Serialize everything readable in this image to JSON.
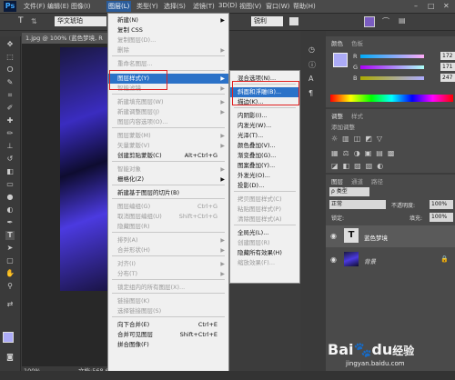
{
  "menubar": {
    "logo": "Ps",
    "items": [
      "文件(F)",
      "编辑(E)",
      "图像(I)",
      "图层(L)",
      "类型(Y)",
      "选择(S)",
      "滤镜(T)",
      "3D(D)",
      "视图(V)",
      "窗口(W)",
      "帮助(H)"
    ],
    "window_buttons": [
      "–",
      "□",
      "✕"
    ]
  },
  "options": {
    "tool_glyph": "T",
    "font_name": "华文琥珀",
    "sharpen": "锐利"
  },
  "document": {
    "tab_title": "1.jpg @ 100% (蓝色梦境, R",
    "zoom": "100%",
    "doc_size": "文档:568.6"
  },
  "layer_menu": {
    "items": [
      {
        "label": "新建(N)",
        "shortcut": "",
        "arrow": true,
        "disabled": false
      },
      {
        "label": "复制 CSS",
        "shortcut": "",
        "arrow": false,
        "disabled": false
      },
      {
        "label": "复制图层(D)...",
        "shortcut": "",
        "arrow": false,
        "disabled": true
      },
      {
        "label": "删除",
        "shortcut": "",
        "arrow": true,
        "disabled": true
      },
      {
        "label": "重命名图层...",
        "shortcut": "",
        "arrow": false,
        "disabled": true
      },
      {
        "label": "图层样式(Y)",
        "shortcut": "",
        "arrow": true,
        "disabled": false
      },
      {
        "label": "智能滤镜",
        "shortcut": "",
        "arrow": true,
        "disabled": true
      },
      {
        "label": "新建填充图层(W)",
        "shortcut": "",
        "arrow": true,
        "disabled": true
      },
      {
        "label": "新建调整图层(J)",
        "shortcut": "",
        "arrow": true,
        "disabled": true
      },
      {
        "label": "图层内容选项(O)...",
        "shortcut": "",
        "arrow": false,
        "disabled": true
      },
      {
        "label": "图层蒙版(M)",
        "shortcut": "",
        "arrow": true,
        "disabled": true
      },
      {
        "label": "矢量蒙版(V)",
        "shortcut": "",
        "arrow": true,
        "disabled": true
      },
      {
        "label": "创建剪贴蒙版(C)",
        "shortcut": "Alt+Ctrl+G",
        "arrow": false,
        "disabled": false
      },
      {
        "label": "智能对象",
        "shortcut": "",
        "arrow": true,
        "disabled": true
      },
      {
        "label": "栅格化(Z)",
        "shortcut": "",
        "arrow": true,
        "disabled": false
      },
      {
        "label": "新建基于图层的切片(B)",
        "shortcut": "",
        "arrow": false,
        "disabled": false
      },
      {
        "label": "图层编组(G)",
        "shortcut": "Ctrl+G",
        "arrow": false,
        "disabled": true
      },
      {
        "label": "取消图层编组(U)",
        "shortcut": "Shift+Ctrl+G",
        "arrow": false,
        "disabled": true
      },
      {
        "label": "隐藏图层(R)",
        "shortcut": "",
        "arrow": false,
        "disabled": true
      },
      {
        "label": "排列(A)",
        "shortcut": "",
        "arrow": true,
        "disabled": true
      },
      {
        "label": "合并形状(H)",
        "shortcut": "",
        "arrow": true,
        "disabled": true
      },
      {
        "label": "对齐(I)",
        "shortcut": "",
        "arrow": true,
        "disabled": true
      },
      {
        "label": "分布(T)",
        "shortcut": "",
        "arrow": true,
        "disabled": true
      },
      {
        "label": "锁定组内的所有图层(X)...",
        "shortcut": "",
        "arrow": false,
        "disabled": true
      },
      {
        "label": "链接图层(K)",
        "shortcut": "",
        "arrow": false,
        "disabled": true
      },
      {
        "label": "选择链接图层(S)",
        "shortcut": "",
        "arrow": false,
        "disabled": true
      },
      {
        "label": "向下合并(E)",
        "shortcut": "Ctrl+E",
        "arrow": false,
        "disabled": false
      },
      {
        "label": "合并可见图层",
        "shortcut": "Shift+Ctrl+E",
        "arrow": false,
        "disabled": false
      },
      {
        "label": "拼合图像(F)",
        "shortcut": "",
        "arrow": false,
        "disabled": false
      }
    ]
  },
  "style_submenu": {
    "items": [
      {
        "label": "混合选项(N)...",
        "disabled": false
      },
      {
        "label": "斜面和浮雕(B)...",
        "disabled": false
      },
      {
        "label": "描边(K)...",
        "disabled": false
      },
      {
        "label": "内阴影(I)...",
        "disabled": false
      },
      {
        "label": "内发光(W)...",
        "disabled": false
      },
      {
        "label": "光泽(T)...",
        "disabled": false
      },
      {
        "label": "颜色叠加(V)...",
        "disabled": false
      },
      {
        "label": "渐变叠加(G)...",
        "disabled": false
      },
      {
        "label": "图案叠加(Y)...",
        "disabled": false
      },
      {
        "label": "外发光(O)...",
        "disabled": false
      },
      {
        "label": "投影(D)...",
        "disabled": false
      },
      {
        "label": "拷贝图层样式(C)",
        "disabled": true
      },
      {
        "label": "粘贴图层样式(P)",
        "disabled": true
      },
      {
        "label": "清除图层样式(A)",
        "disabled": true
      },
      {
        "label": "全局光(L)...",
        "disabled": false
      },
      {
        "label": "创建图层(R)",
        "disabled": true
      },
      {
        "label": "隐藏所有效果(H)",
        "disabled": false
      },
      {
        "label": "缩放效果(F)...",
        "disabled": true
      }
    ]
  },
  "color_panel": {
    "tabs": [
      "颜色",
      "色板"
    ],
    "r": "172",
    "g": "171",
    "b": "247",
    "labels": [
      "R",
      "G",
      "B"
    ],
    "foreground": "#acabf7"
  },
  "adjust_panel": {
    "tabs": [
      "调整",
      "样式"
    ],
    "title": "添加调整"
  },
  "layers_panel": {
    "tabs": [
      "图层",
      "通道",
      "路径"
    ],
    "kind": "ρ 类型",
    "blend_mode": "正常",
    "opacity_label": "不透明度:",
    "opacity": "100%",
    "lock_label": "锁定:",
    "fill_label": "填充:",
    "fill": "100%",
    "layers": [
      {
        "name": "蓝色梦境",
        "thumb": "T"
      },
      {
        "name": "背景"
      }
    ]
  },
  "watermark": {
    "brand": "Bai",
    "paw": "🐾",
    "du": "du",
    "text": "经验",
    "url": "jingyan.baidu.com"
  }
}
